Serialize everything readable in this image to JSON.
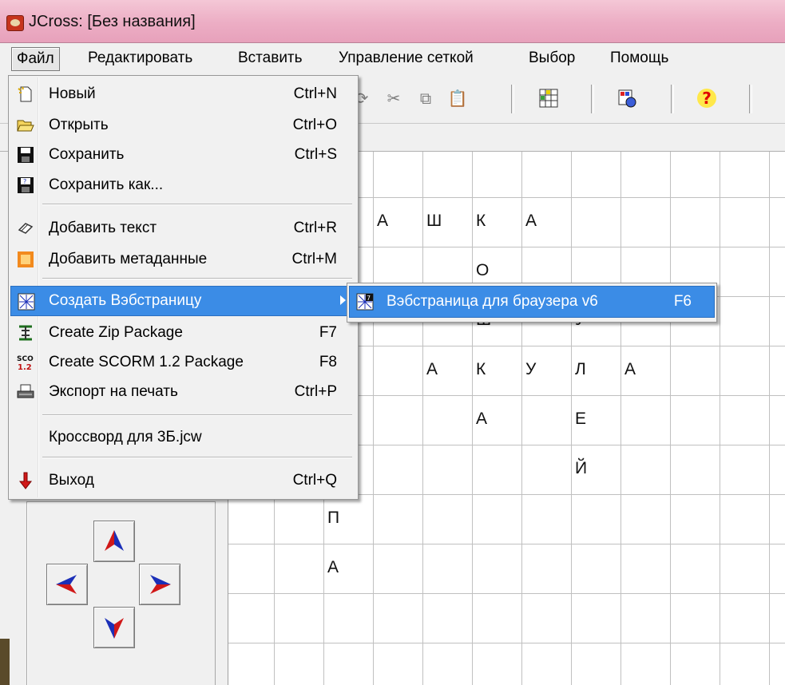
{
  "window": {
    "title": "JCross: [Без названия]"
  },
  "menubar": [
    "Файл",
    "Редактировать",
    "Вставить",
    "Управление сеткой",
    "Выбор",
    "Помощь"
  ],
  "file_menu": [
    {
      "label": "Новый",
      "shortcut": "Ctrl+N",
      "icon": "new-document-icon"
    },
    {
      "label": "Открыть",
      "shortcut": "Ctrl+O",
      "icon": "open-folder-icon"
    },
    {
      "label": "Сохранить",
      "shortcut": "Ctrl+S",
      "icon": "save-disk-icon"
    },
    {
      "label": "Сохранить как...",
      "shortcut": "",
      "icon": "save-as-icon"
    },
    {
      "label": "Добавить текст",
      "shortcut": "Ctrl+R",
      "icon": "add-text-icon"
    },
    {
      "label": "Добавить метаданные",
      "shortcut": "Ctrl+M",
      "icon": "metadata-icon"
    },
    {
      "label": "Создать Вэбстраницу",
      "shortcut": "",
      "icon": "web-page-icon"
    },
    {
      "label": "Create Zip Package",
      "shortcut": "F7",
      "icon": "zip-icon"
    },
    {
      "label": "Create SCORM 1.2 Package",
      "shortcut": "F8",
      "icon": "scorm-icon"
    },
    {
      "label": "Экспорт на печать",
      "shortcut": "Ctrl+P",
      "icon": "print-icon"
    },
    {
      "label": "Кроссворд для 3Б.jcw",
      "shortcut": "",
      "icon": ""
    },
    {
      "label": "Выход",
      "shortcut": "Ctrl+Q",
      "icon": "exit-arrow-icon"
    }
  ],
  "submenu": {
    "label": "Вэбстраница для браузера v6",
    "shortcut": "F6"
  },
  "toolbar": {
    "help_label": "?"
  },
  "grid_letters": [
    {
      "ch": "А"
    },
    {
      "ch": "Ш"
    },
    {
      "ch": "К"
    },
    {
      "ch": "А"
    },
    {
      "ch": "О"
    },
    {
      "ch": "Ш"
    },
    {
      "ch": "У"
    },
    {
      "ch": "А"
    },
    {
      "ch": "К"
    },
    {
      "ch": "У"
    },
    {
      "ch": "Л"
    },
    {
      "ch": "А"
    },
    {
      "ch": "А"
    },
    {
      "ch": "Е"
    },
    {
      "ch": "Й"
    },
    {
      "ch": "П"
    },
    {
      "ch": "А"
    }
  ],
  "colors": {
    "titlebar": "#ecadc4",
    "highlight": "#3b8ce6",
    "arrow_blue": "#1b2fb8",
    "arrow_red": "#d01818"
  }
}
